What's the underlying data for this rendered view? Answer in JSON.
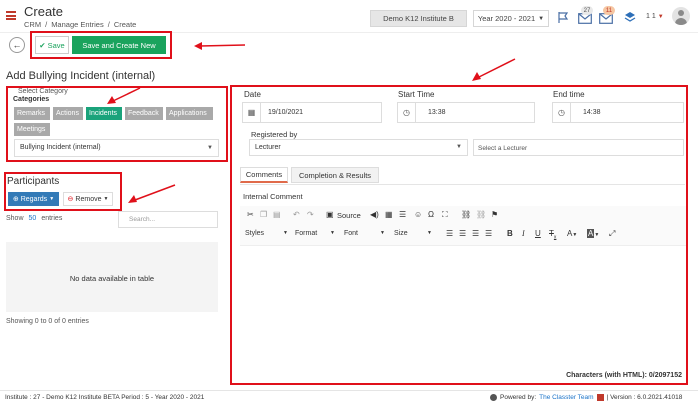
{
  "header": {
    "title": "Create",
    "breadcrumb": [
      "CRM",
      "/",
      "Manage Entries",
      "/",
      "Create"
    ],
    "institute": "Demo K12 Institute B",
    "year": "Year 2020 - 2021",
    "badge_messages": "27",
    "badge_notifications": "11",
    "user_label": "1 1"
  },
  "actions": {
    "save": "Save",
    "save_create_new": "Save and Create New"
  },
  "form": {
    "title": "Add Bullying Incident (internal)",
    "select_category": "Select Category",
    "categories_label": "Categories",
    "tags": [
      "Remarks",
      "Actions",
      "Incidents",
      "Feedback",
      "Applications",
      "Meetings"
    ],
    "category_value": "Bullying Incident (internal)"
  },
  "participants": {
    "title": "Participants",
    "regards": "Regards",
    "remove": "Remove",
    "show": "Show",
    "show_count": "50",
    "entries": "entries",
    "search_placeholder": "Search...",
    "empty": "No data available in table",
    "info": "Showing 0 to 0 of 0 entries"
  },
  "details": {
    "date_label": "Date",
    "date_value": "19/10/2021",
    "start_label": "Start Time",
    "start_value": "13:38",
    "end_label": "End time",
    "end_value": "14:38",
    "registered_label": "Registered by",
    "registered_value": "Lecturer",
    "lecturer_placeholder": "Select a Lecturer",
    "tab_comments": "Comments",
    "tab_completion": "Completion & Results",
    "internal_comment": "Internal Comment",
    "source": "Source",
    "styles": "Styles",
    "format": "Format",
    "font": "Font",
    "size": "Size",
    "char_count": "Characters (with HTML): 0/2097152"
  },
  "footer": {
    "left": "Institute : 27 - Demo K12 Institute BETA Period : 5 - Year 2020 - 2021",
    "powered": "Powered by:",
    "team": "The Classter Team",
    "version": "| Version : 6.0.2021.41018"
  },
  "colors": {
    "brand_red": "#c0392b",
    "save_green": "#1aa35d",
    "tag_grey": "#a9a9a9",
    "tag_active": "#1aa37b",
    "regards_blue": "#337ab7",
    "link_blue": "#1a73c9",
    "annotation_red": "#e0101a"
  }
}
